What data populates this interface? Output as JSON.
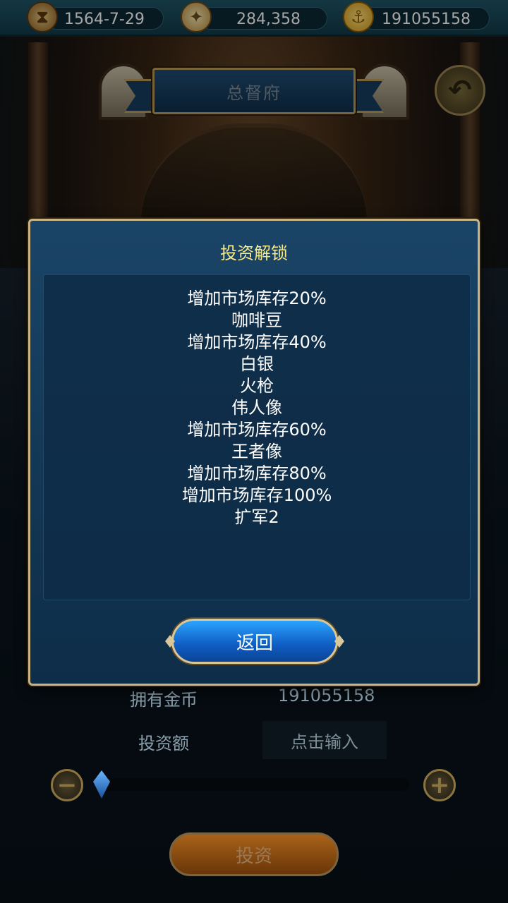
{
  "topbar": {
    "date": "1564-7-29",
    "reputation": "284,358",
    "gold": "191055158"
  },
  "icons": {
    "date": "hourglass-icon",
    "reputation": "compass-icon",
    "gold": "gold-anchor-coin-icon",
    "back": "back-arrow-icon"
  },
  "header": {
    "title": "总督府"
  },
  "background": {
    "owned_gold_label": "拥有金币",
    "owned_gold_value": "191055158",
    "invest_amount_label": "投资额",
    "invest_input_placeholder": "点击输入",
    "minus": "−",
    "plus": "+",
    "invest_button": "投资"
  },
  "modal": {
    "title": "投资解锁",
    "items": [
      "增加市场库存20%",
      "咖啡豆",
      "增加市场库存40%",
      "白银",
      "火枪",
      "伟人像",
      "增加市场库存60%",
      "王者像",
      "增加市场库存80%",
      "增加市场库存100%",
      "扩军2"
    ],
    "return_button": "返回"
  },
  "colors": {
    "modal_title": "#f6e98a",
    "modal_border": "#c9b487",
    "return_button": "#1a7ae6"
  }
}
